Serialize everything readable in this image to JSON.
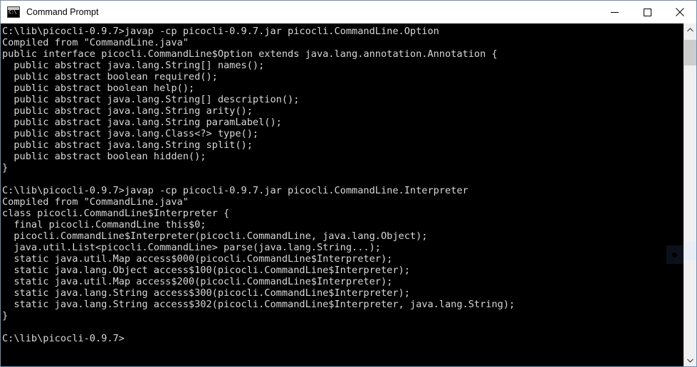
{
  "window": {
    "title": "Command Prompt",
    "icon": "command-prompt-icon",
    "icon_glyph": "C:\\",
    "controls": {
      "minimize": "Minimize",
      "maximize": "Maximize",
      "close": "Close"
    }
  },
  "colors": {
    "titlebar_bg": "#ffffff",
    "console_bg": "#000000",
    "console_fg": "#d8d8d8",
    "window_border": "#6f8faf",
    "scrollbar_track": "#f0f0f0",
    "scrollbar_thumb": "#cdcdcd"
  },
  "scrollbar": {
    "up_arrow": "scroll-up-arrow",
    "down_arrow": "scroll-down-arrow",
    "thumb": "scroll-thumb"
  },
  "console": {
    "prompt": "C:\\lib\\picocli-0.9.7>",
    "lines": [
      "C:\\lib\\picocli-0.9.7>javap -cp picocli-0.9.7.jar picocli.CommandLine.Option",
      "Compiled from \"CommandLine.java\"",
      "public interface picocli.CommandLine$Option extends java.lang.annotation.Annotation {",
      "  public abstract java.lang.String[] names();",
      "  public abstract boolean required();",
      "  public abstract boolean help();",
      "  public abstract java.lang.String[] description();",
      "  public abstract java.lang.String arity();",
      "  public abstract java.lang.String paramLabel();",
      "  public abstract java.lang.Class<?> type();",
      "  public abstract java.lang.String split();",
      "  public abstract boolean hidden();",
      "}",
      "",
      "C:\\lib\\picocli-0.9.7>javap -cp picocli-0.9.7.jar picocli.CommandLine.Interpreter",
      "Compiled from \"CommandLine.java\"",
      "class picocli.CommandLine$Interpreter {",
      "  final picocli.CommandLine this$0;",
      "  picocli.CommandLine$Interpreter(picocli.CommandLine, java.lang.Object);",
      "  java.util.List<picocli.CommandLine> parse(java.lang.String...);",
      "  static java.util.Map access$000(picocli.CommandLine$Interpreter);",
      "  static java.lang.Object access$100(picocli.CommandLine$Interpreter);",
      "  static java.util.Map access$200(picocli.CommandLine$Interpreter);",
      "  static java.lang.String access$300(picocli.CommandLine$Interpreter);",
      "  static java.lang.String access$302(picocli.CommandLine$Interpreter, java.lang.String);",
      "}",
      "",
      "C:\\lib\\picocli-0.9.7>"
    ]
  }
}
